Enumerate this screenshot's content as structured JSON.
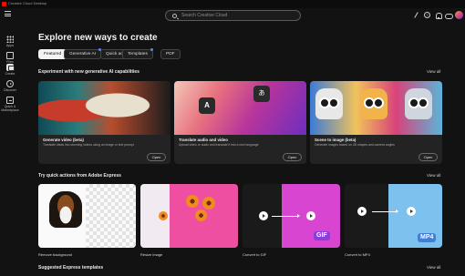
{
  "window": {
    "title": "Creative Cloud Desktop"
  },
  "topbar": {
    "search_placeholder": "Search Creative Cloud"
  },
  "nav": {
    "items": [
      {
        "label": "Apps",
        "icon": "apps-icon"
      },
      {
        "label": "Files",
        "icon": "files-icon"
      },
      {
        "label": "Create",
        "icon": "create-icon",
        "active": true
      },
      {
        "label": "Discover",
        "icon": "discover-icon"
      },
      {
        "label": "Quick & Marketplace",
        "icon": "quick-actions-icon"
      }
    ]
  },
  "main": {
    "heading": "Explore new ways to create",
    "tabs": [
      {
        "label": "Featured",
        "selected": true
      },
      {
        "label": "Generative AI",
        "dot": true
      },
      {
        "label": "Quick actions"
      },
      {
        "label": "Templates",
        "dot": true
      },
      {
        "label": "PDF"
      }
    ],
    "view_all": "View all",
    "sections": {
      "ai": {
        "title": "Experiment with new generative AI capabilities",
        "cards": [
          {
            "title": "Generate video (beta)",
            "desc": "Translate ideas into stunning videos using an image or text prompt",
            "button": "Open"
          },
          {
            "title": "Translate audio and video",
            "desc": "Upload video or audio and translate it into a new language",
            "button": "Open",
            "glyph_a": "A",
            "glyph_b": "あ"
          },
          {
            "title": "Scene to image (beta)",
            "desc": "Generate images based on 3D shapes and camera angles",
            "button": "Open"
          }
        ]
      },
      "quick": {
        "title": "Try quick actions from Adobe Express",
        "cards": [
          {
            "label": "Remove background"
          },
          {
            "label": "Resize image"
          },
          {
            "label": "Convert to GIF",
            "badge": "GIF"
          },
          {
            "label": "Convert to MP4",
            "badge": "MP4"
          }
        ]
      },
      "templates": {
        "title": "Suggested Express templates"
      }
    }
  },
  "colors": {
    "background": "#121212",
    "card": "#232323",
    "accent_dot": "#4a8cff",
    "gif_badge": "#8a3fd6",
    "mp4_badge": "#3d7fd9"
  }
}
